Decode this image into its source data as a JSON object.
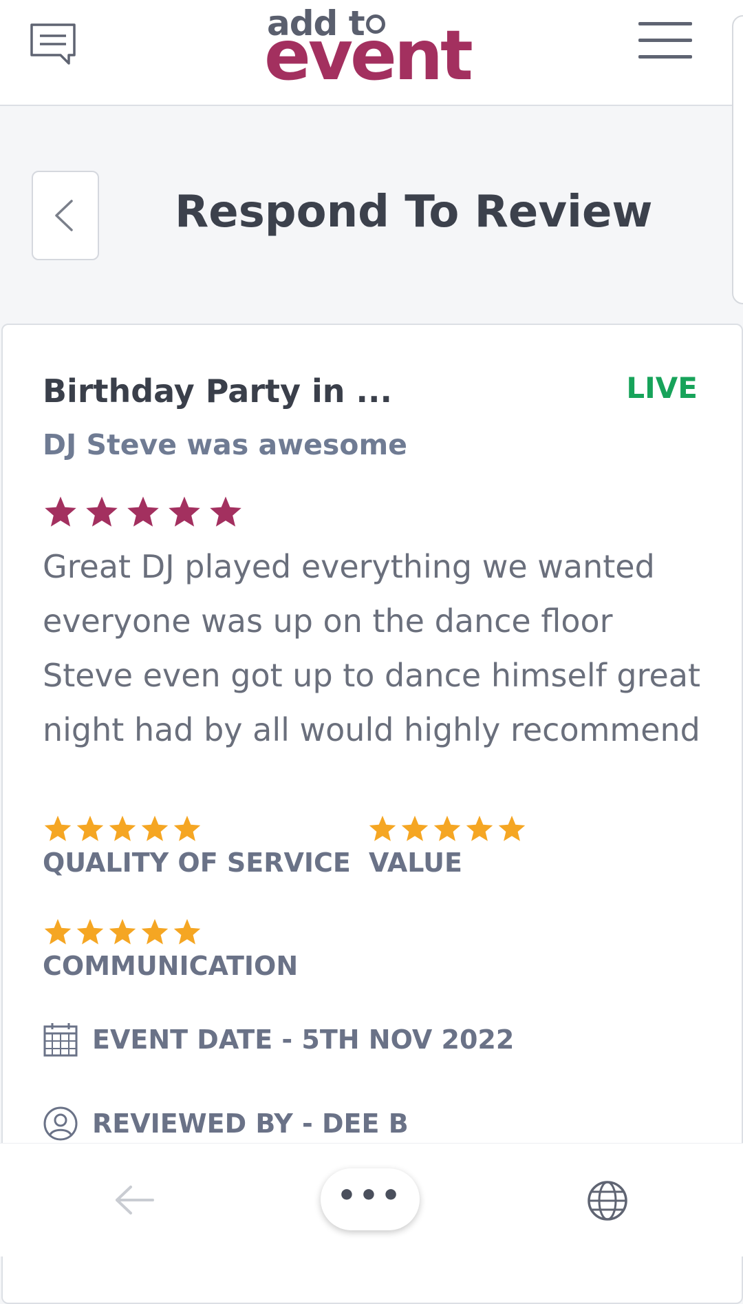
{
  "header": {
    "logo_line1": "add t",
    "logo_line2": "event"
  },
  "page": {
    "title": "Respond To Review"
  },
  "review": {
    "event_title": "Birthday Party in ...",
    "status": "LIVE",
    "headline": "DJ Steve was awesome",
    "overall_rating": 5,
    "text": "Great DJ played everything we wanted\neveryone was up on the dance floor\nSteve even got up to dance himself great\nnight had by all would highly recommend",
    "ratings": [
      {
        "label": "QUALITY OF SERVICE",
        "stars": 5
      },
      {
        "label": "VALUE",
        "stars": 5
      },
      {
        "label": "COMMUNICATION",
        "stars": 5
      }
    ],
    "event_date": "EVENT DATE - 5TH NOV 2022",
    "reviewed_by": "REVIEWED BY - DEE B"
  },
  "bottom_bar": {
    "more_label": "•••"
  },
  "colors": {
    "brand": "#a3305f",
    "live": "#17a35a",
    "rating_star": "#f5a623",
    "overall_star": "#a3305f"
  },
  "icons": {
    "chat": "chat-icon",
    "menu": "menu-icon",
    "back": "chevron-left-icon",
    "calendar": "calendar-icon",
    "user": "user-icon",
    "nav_back": "arrow-left-icon",
    "translate": "translate-icon"
  }
}
